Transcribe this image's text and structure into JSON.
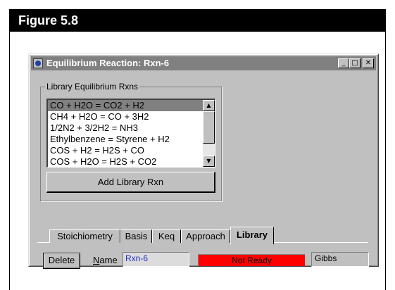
{
  "figure": {
    "title": "Figure 5.8"
  },
  "window": {
    "title": "Equilibrium Reaction: Rxn-6",
    "controls": {
      "minimize": "_",
      "maximize": "□",
      "close": "✕"
    }
  },
  "library": {
    "group_label": "Library Equilibrium Rxns",
    "items": [
      "CO + H2O  = CO2 + H2",
      "CH4 + H2O = CO + 3H2",
      "1/2N2 + 3/2H2 = NH3",
      "Ethylbenzene = Styrene + H2",
      "COS + H2 = H2S + CO",
      "COS + H2O = H2S + CO2"
    ],
    "selected_index": 0,
    "add_button": "Add Library Rxn",
    "scroll_up": "▲",
    "scroll_down": "▼"
  },
  "tabs": [
    {
      "label": "Stoichiometry"
    },
    {
      "label": "Basis"
    },
    {
      "label": "Keq"
    },
    {
      "label": "Approach"
    },
    {
      "label": "Library"
    }
  ],
  "active_tab": "Library",
  "footer": {
    "delete_label": "Delete",
    "name_label_underlined": "N",
    "name_label_rest": "ame",
    "name_value": "Rxn-6",
    "status": "Not Ready",
    "type_value": "Gibbs"
  },
  "colors": {
    "status_bg": "#ff0000",
    "name_text": "#2030c0",
    "titlebar_bg": "#808080",
    "window_bg": "#c0c0c0"
  }
}
